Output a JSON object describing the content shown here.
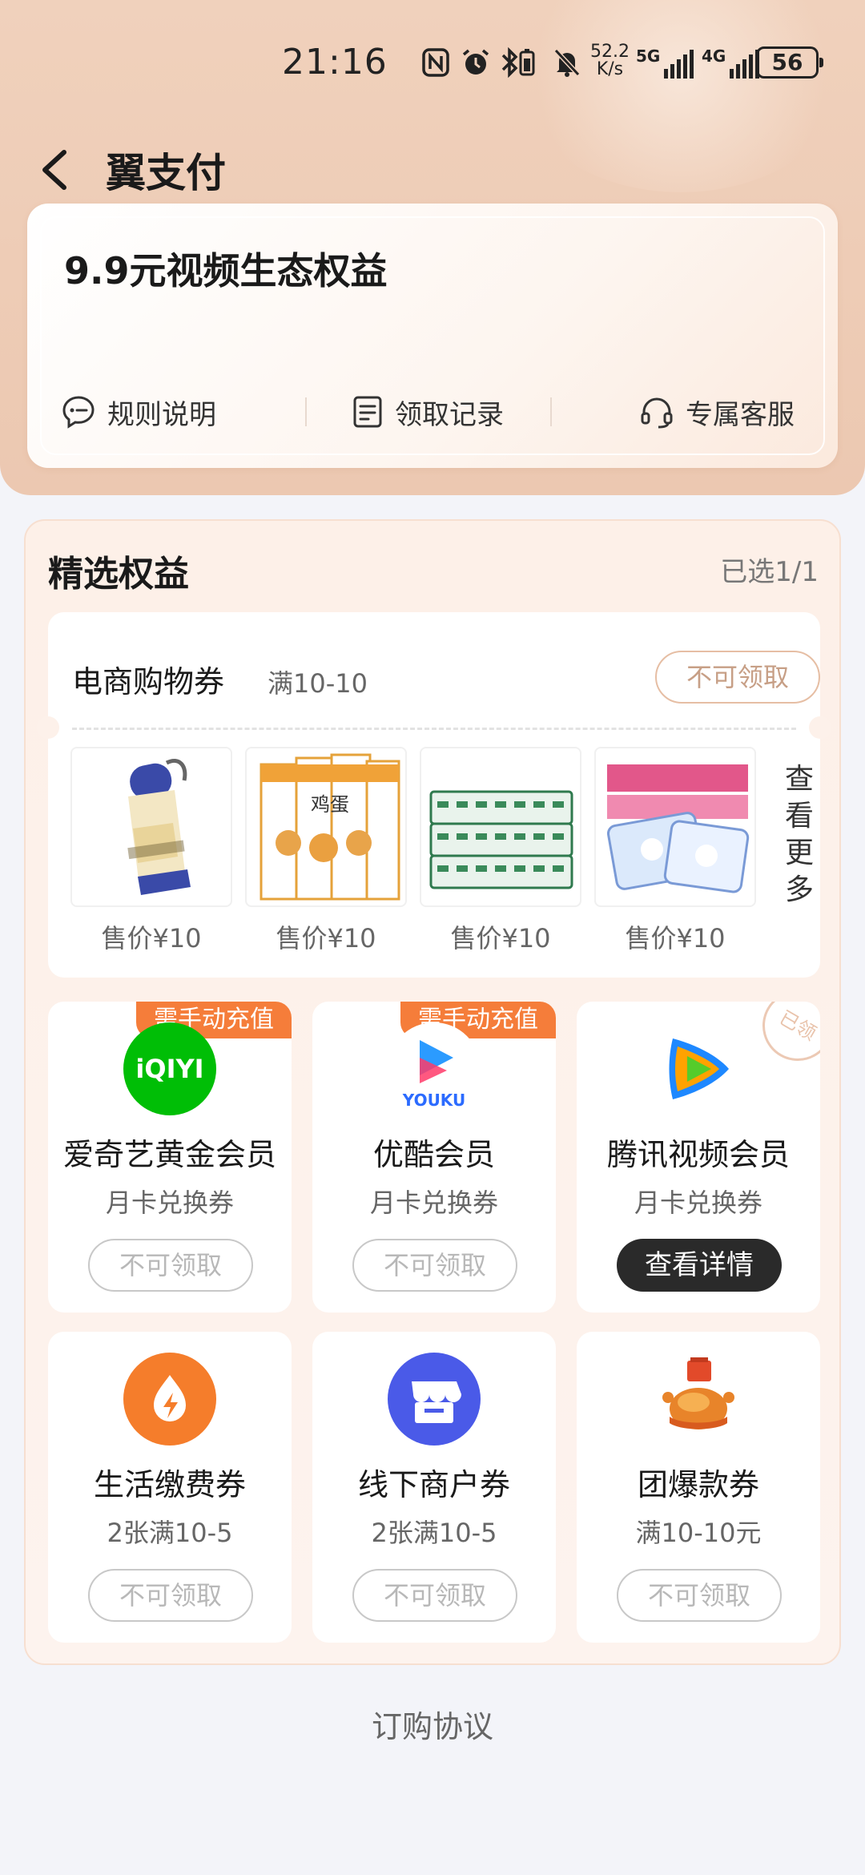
{
  "status_bar": {
    "time": "21:16",
    "speed_value": "52.2",
    "speed_unit": "K/s",
    "sim1_label": "5G",
    "sim2_label": "4G",
    "battery": "56"
  },
  "header": {
    "title": "翼支付"
  },
  "hero_card": {
    "title": "9.9元视频生态权益",
    "links": [
      {
        "label": "规则说明",
        "icon": "chat-bubble-icon"
      },
      {
        "label": "领取记录",
        "icon": "document-icon"
      },
      {
        "label": "专属客服",
        "icon": "headset-icon"
      }
    ]
  },
  "benefits": {
    "title": "精选权益",
    "selected": "已选1/1",
    "shopping": {
      "name": "电商购物券",
      "condition": "满10-10",
      "button": "不可领取",
      "products": [
        {
          "price": "售价¥10",
          "image": "water-bottle"
        },
        {
          "price": "售价¥10",
          "image": "egg-noodles"
        },
        {
          "price": "售价¥10",
          "image": "tissue-packs"
        },
        {
          "price": "售价¥10",
          "image": "wet-wipes"
        }
      ],
      "more_label": "查看更多"
    },
    "cards": [
      {
        "tag": "需手动充值",
        "title": "爱奇艺黄金会员",
        "sub": "月卡兑换券",
        "button": "不可领取",
        "logo_text": "iQIYI",
        "color": "#00be06"
      },
      {
        "tag": "需手动充值",
        "title": "优酷会员",
        "sub": "月卡兑换券",
        "button": "不可领取",
        "logo_text": "YOUKU",
        "color": "#2b9bff"
      },
      {
        "stamp": "已领",
        "title": "腾讯视频会员",
        "sub": "月卡兑换券",
        "button": "查看详情"
      },
      {
        "title": "生活缴费券",
        "sub": "2张满10-5",
        "button": "不可领取",
        "color": "#f57d2b"
      },
      {
        "title": "线下商户券",
        "sub": "2张满10-5",
        "button": "不可领取",
        "color": "#4a5ae8"
      },
      {
        "title": "团爆款券",
        "sub": "满10-10元",
        "button": "不可领取"
      }
    ]
  },
  "footer": {
    "agreement": "订购协议"
  }
}
